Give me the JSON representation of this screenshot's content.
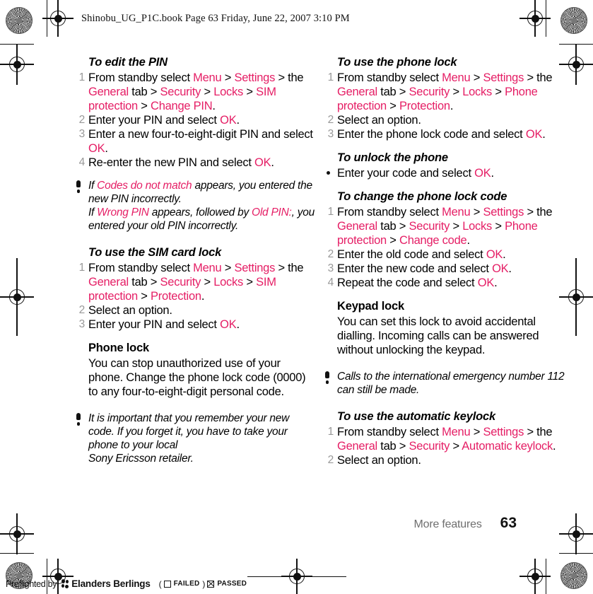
{
  "header": {
    "slug": "Shinobu_UG_P1C.book  Page 63  Friday, June 22, 2007  3:10 PM"
  },
  "accent_color": "#E51E65",
  "left_column": {
    "section1": {
      "heading": "To edit the PIN",
      "steps": [
        {
          "num": "1",
          "parts": [
            {
              "t": "From standby select ",
              "hl": false
            },
            {
              "t": "Menu",
              "hl": true
            },
            {
              "t": " > ",
              "hl": false
            },
            {
              "t": "Settings",
              "hl": true
            },
            {
              "t": " > the ",
              "hl": false
            },
            {
              "t": "General",
              "hl": true
            },
            {
              "t": " tab > ",
              "hl": false
            },
            {
              "t": "Security",
              "hl": true
            },
            {
              "t": " > ",
              "hl": false
            },
            {
              "t": "Locks",
              "hl": true
            },
            {
              "t": " > ",
              "hl": false
            },
            {
              "t": "SIM protection",
              "hl": true
            },
            {
              "t": " > ",
              "hl": false
            },
            {
              "t": "Change PIN",
              "hl": true
            },
            {
              "t": ".",
              "hl": false
            }
          ]
        },
        {
          "num": "2",
          "parts": [
            {
              "t": "Enter your PIN and select ",
              "hl": false
            },
            {
              "t": "OK",
              "hl": true
            },
            {
              "t": ".",
              "hl": false
            }
          ]
        },
        {
          "num": "3",
          "parts": [
            {
              "t": "Enter a new four-to-eight-digit PIN and select ",
              "hl": false
            },
            {
              "t": "OK",
              "hl": true
            },
            {
              "t": ".",
              "hl": false
            }
          ]
        },
        {
          "num": "4",
          "parts": [
            {
              "t": "Re-enter the new PIN and select ",
              "hl": false
            },
            {
              "t": "OK",
              "hl": true
            },
            {
              "t": ".",
              "hl": false
            }
          ]
        }
      ]
    },
    "note1": {
      "icon": "exclamation-icon",
      "parts": [
        {
          "t": "If ",
          "hl": false
        },
        {
          "t": "Codes do not match",
          "hl": true
        },
        {
          "t": " appears, you entered the new PIN incorrectly.",
          "hl": false
        },
        {
          "t": "\nIf ",
          "hl": false
        },
        {
          "t": "Wrong PIN",
          "hl": true
        },
        {
          "t": " appears, followed by ",
          "hl": false
        },
        {
          "t": "Old PIN:",
          "hl": true
        },
        {
          "t": ", you entered your old PIN incorrectly.",
          "hl": false
        }
      ]
    },
    "section2": {
      "heading": "To use the SIM card lock",
      "steps": [
        {
          "num": "1",
          "parts": [
            {
              "t": "From standby select ",
              "hl": false
            },
            {
              "t": "Menu",
              "hl": true
            },
            {
              "t": " > ",
              "hl": false
            },
            {
              "t": "Settings",
              "hl": true
            },
            {
              "t": " > the ",
              "hl": false
            },
            {
              "t": "General",
              "hl": true
            },
            {
              "t": " tab > ",
              "hl": false
            },
            {
              "t": "Security",
              "hl": true
            },
            {
              "t": " > ",
              "hl": false
            },
            {
              "t": "Locks",
              "hl": true
            },
            {
              "t": " > ",
              "hl": false
            },
            {
              "t": "SIM protection",
              "hl": true
            },
            {
              "t": " > ",
              "hl": false
            },
            {
              "t": "Protection",
              "hl": true
            },
            {
              "t": ".",
              "hl": false
            }
          ]
        },
        {
          "num": "2",
          "parts": [
            {
              "t": "Select an option.",
              "hl": false
            }
          ]
        },
        {
          "num": "3",
          "parts": [
            {
              "t": "Enter your PIN and select ",
              "hl": false
            },
            {
              "t": "OK",
              "hl": true
            },
            {
              "t": ".",
              "hl": false
            }
          ]
        }
      ]
    },
    "section3": {
      "heading": "Phone lock",
      "body": "You can stop unauthorized use of your phone. Change the phone lock code (0000) to any four-to-eight-digit personal code."
    },
    "note2": {
      "icon": "exclamation-icon",
      "parts": [
        {
          "t": "It is important that you remember your new code. If you forget it, you have to take your phone to your local",
          "hl": false
        },
        {
          "t": "\nSony Ericsson retailer.",
          "hl": false
        }
      ]
    }
  },
  "right_column": {
    "section1": {
      "heading": "To use the phone lock",
      "steps": [
        {
          "num": "1",
          "parts": [
            {
              "t": "From standby select ",
              "hl": false
            },
            {
              "t": "Menu",
              "hl": true
            },
            {
              "t": " > ",
              "hl": false
            },
            {
              "t": "Settings",
              "hl": true
            },
            {
              "t": " > the ",
              "hl": false
            },
            {
              "t": "General",
              "hl": true
            },
            {
              "t": " tab > ",
              "hl": false
            },
            {
              "t": "Security",
              "hl": true
            },
            {
              "t": " > ",
              "hl": false
            },
            {
              "t": "Locks",
              "hl": true
            },
            {
              "t": " > ",
              "hl": false
            },
            {
              "t": "Phone protection",
              "hl": true
            },
            {
              "t": " > ",
              "hl": false
            },
            {
              "t": "Protection",
              "hl": true
            },
            {
              "t": ".",
              "hl": false
            }
          ]
        },
        {
          "num": "2",
          "parts": [
            {
              "t": "Select an option.",
              "hl": false
            }
          ]
        },
        {
          "num": "3",
          "parts": [
            {
              "t": "Enter the phone lock code and select ",
              "hl": false
            },
            {
              "t": "OK",
              "hl": true
            },
            {
              "t": ".",
              "hl": false
            }
          ]
        }
      ]
    },
    "section2": {
      "heading": "To unlock the phone",
      "bullets": [
        {
          "parts": [
            {
              "t": "Enter your code and select ",
              "hl": false
            },
            {
              "t": "OK",
              "hl": true
            },
            {
              "t": ".",
              "hl": false
            }
          ]
        }
      ]
    },
    "section3": {
      "heading": "To change the phone lock code",
      "steps": [
        {
          "num": "1",
          "parts": [
            {
              "t": "From standby select ",
              "hl": false
            },
            {
              "t": "Menu",
              "hl": true
            },
            {
              "t": " > ",
              "hl": false
            },
            {
              "t": "Settings",
              "hl": true
            },
            {
              "t": " > the ",
              "hl": false
            },
            {
              "t": "General",
              "hl": true
            },
            {
              "t": " tab > ",
              "hl": false
            },
            {
              "t": "Security",
              "hl": true
            },
            {
              "t": " > ",
              "hl": false
            },
            {
              "t": "Locks",
              "hl": true
            },
            {
              "t": " > ",
              "hl": false
            },
            {
              "t": "Phone protection",
              "hl": true
            },
            {
              "t": " > ",
              "hl": false
            },
            {
              "t": "Change code",
              "hl": true
            },
            {
              "t": ".",
              "hl": false
            }
          ]
        },
        {
          "num": "2",
          "parts": [
            {
              "t": "Enter the old code and select ",
              "hl": false
            },
            {
              "t": "OK",
              "hl": true
            },
            {
              "t": ".",
              "hl": false
            }
          ]
        },
        {
          "num": "3",
          "parts": [
            {
              "t": "Enter the new code and select ",
              "hl": false
            },
            {
              "t": "OK",
              "hl": true
            },
            {
              "t": ".",
              "hl": false
            }
          ]
        },
        {
          "num": "4",
          "parts": [
            {
              "t": "Repeat the code and select ",
              "hl": false
            },
            {
              "t": "OK",
              "hl": true
            },
            {
              "t": ".",
              "hl": false
            }
          ]
        }
      ]
    },
    "section4": {
      "heading": "Keypad lock",
      "body": "You can set this lock to avoid accidental dialling. Incoming calls can be answered without unlocking the keypad."
    },
    "note1": {
      "icon": "exclamation-icon",
      "parts": [
        {
          "t": "Calls to the international emergency number 112 can still be made.",
          "hl": false
        }
      ]
    },
    "section5": {
      "heading": "To use the automatic keylock",
      "steps": [
        {
          "num": "1",
          "parts": [
            {
              "t": "From standby select ",
              "hl": false
            },
            {
              "t": "Menu",
              "hl": true
            },
            {
              "t": " > ",
              "hl": false
            },
            {
              "t": "Settings",
              "hl": true
            },
            {
              "t": " > the ",
              "hl": false
            },
            {
              "t": "General",
              "hl": true
            },
            {
              "t": " tab > ",
              "hl": false
            },
            {
              "t": "Security",
              "hl": true
            },
            {
              "t": " > ",
              "hl": false
            },
            {
              "t": "Automatic keylock",
              "hl": true
            },
            {
              "t": ".",
              "hl": false
            }
          ]
        },
        {
          "num": "2",
          "parts": [
            {
              "t": "Select an option.",
              "hl": false
            }
          ]
        }
      ]
    }
  },
  "footer": {
    "chapter": "More features",
    "page_number": "63"
  },
  "preflight": {
    "by_label": "Preflighted by",
    "company": "Elanders Berlings",
    "open_paren": "(",
    "failed_label": "FAILED",
    "close_paren": ")",
    "passed_label": "PASSED",
    "failed_checked": false,
    "passed_checked": true
  }
}
